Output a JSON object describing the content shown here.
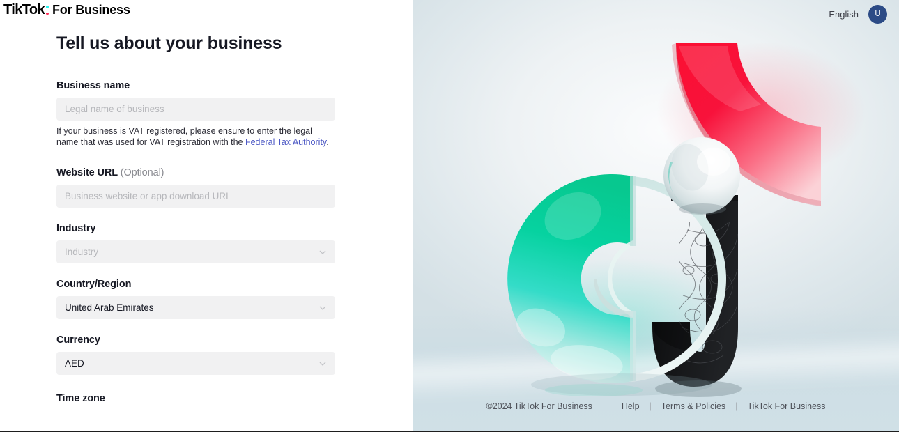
{
  "brand": {
    "tiktok": "TikTok",
    "for_business": "For Business",
    "colon_top_color": "#25f4ee",
    "colon_bottom_color": "#fe2c55"
  },
  "page": {
    "title": "Tell us about your business"
  },
  "form": {
    "business_name": {
      "label": "Business name",
      "placeholder": "Legal name of business",
      "value": "",
      "helper_part1": "If your business is VAT registered, please ensure to enter the legal name that was used for VAT registration with the ",
      "helper_link": "Federal Tax Authority",
      "helper_part2": "."
    },
    "website_url": {
      "label": "Website URL",
      "optional": "(Optional)",
      "placeholder": "Business website or app download URL",
      "value": ""
    },
    "industry": {
      "label": "Industry",
      "placeholder": "Industry",
      "value": "",
      "icon": "chevron-down-icon"
    },
    "country_region": {
      "label": "Country/Region",
      "value": "United Arab Emirates",
      "icon": "chevron-down-icon"
    },
    "currency": {
      "label": "Currency",
      "value": "AED",
      "icon": "chevron-down-icon"
    },
    "time_zone": {
      "label": "Time zone"
    }
  },
  "topbar": {
    "language": "English",
    "avatar_initial": "U",
    "avatar_color": "#2c4b86"
  },
  "footer": {
    "copyright": "©2024 TikTok For Business",
    "help": "Help",
    "terms": "Terms & Policies",
    "tiktok_for_business": "TikTok For Business",
    "separator": "|"
  },
  "hero": {
    "description": "3D abstract glass sculpture composed of a red curved arc, a white marble sphere, a teal gradient C-shape and a black textured J-shape on a pale blue-gray studio background",
    "red_arc_color": "#f5143c",
    "teal_color": "#00d19a",
    "black_color": "#121214",
    "sphere_color": "#f2f4f5"
  }
}
